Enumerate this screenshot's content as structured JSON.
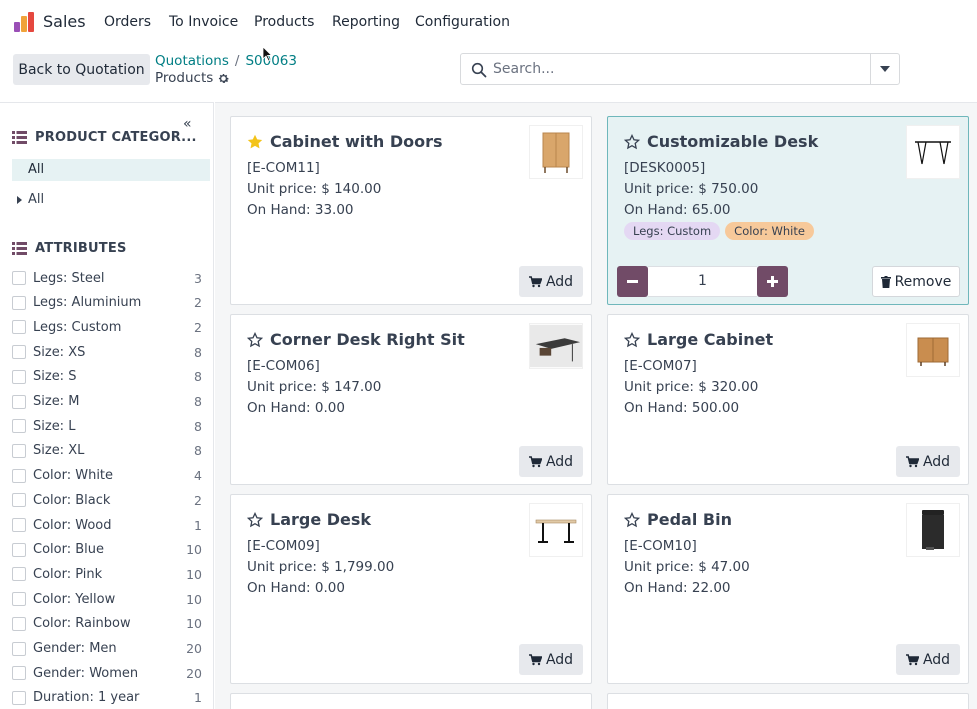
{
  "app": {
    "name": "Sales"
  },
  "menu": [
    "Orders",
    "To Invoice",
    "Products",
    "Reporting",
    "Configuration"
  ],
  "control": {
    "back_label": "Back to Quotation",
    "breadcrumb": [
      "Quotations",
      "S00063"
    ],
    "breadcrumb_sep": "/",
    "subtitle": "Products",
    "search_placeholder": "Search..."
  },
  "sidebar": {
    "collapse_glyph": "«",
    "categories_title": "PRODUCT CATEGOR...",
    "category_active": "All",
    "category_child": "All",
    "attributes_title": "ATTRIBUTES",
    "attributes": [
      {
        "label": "Legs: Steel",
        "count": "3"
      },
      {
        "label": "Legs: Aluminium",
        "count": "2"
      },
      {
        "label": "Legs: Custom",
        "count": "2"
      },
      {
        "label": "Size: XS",
        "count": "8"
      },
      {
        "label": "Size: S",
        "count": "8"
      },
      {
        "label": "Size: M",
        "count": "8"
      },
      {
        "label": "Size: L",
        "count": "8"
      },
      {
        "label": "Size: XL",
        "count": "8"
      },
      {
        "label": "Color: White",
        "count": "4"
      },
      {
        "label": "Color: Black",
        "count": "2"
      },
      {
        "label": "Color: Wood",
        "count": "1"
      },
      {
        "label": "Color: Blue",
        "count": "10"
      },
      {
        "label": "Color: Pink",
        "count": "10"
      },
      {
        "label": "Color: Yellow",
        "count": "10"
      },
      {
        "label": "Color: Rainbow",
        "count": "10"
      },
      {
        "label": "Gender: Men",
        "count": "20"
      },
      {
        "label": "Gender: Women",
        "count": "20"
      },
      {
        "label": "Duration: 1 year",
        "count": "1"
      }
    ]
  },
  "products": [
    {
      "name": "Cabinet with Doors",
      "ref": "[E-COM11]",
      "price": "Unit price: $ 140.00",
      "onhand": "On Hand: 33.00",
      "favorite": true,
      "selected": false,
      "add_label": "Add",
      "thumb": "cabinet"
    },
    {
      "name": "Customizable Desk",
      "ref": "[DESK0005]",
      "price": "Unit price: $ 750.00",
      "onhand": "On Hand: 65.00",
      "favorite": false,
      "selected": true,
      "tags": [
        "Legs: Custom",
        "Color: White"
      ],
      "qty": "1",
      "remove_label": "Remove",
      "thumb": "desk-frame"
    },
    {
      "name": "Corner Desk Right Sit",
      "ref": "[E-COM06]",
      "price": "Unit price: $ 147.00",
      "onhand": "On Hand: 0.00",
      "favorite": false,
      "selected": false,
      "add_label": "Add",
      "thumb": "corner-desk"
    },
    {
      "name": "Large Cabinet",
      "ref": "[E-COM07]",
      "price": "Unit price: $ 320.00",
      "onhand": "On Hand: 500.00",
      "favorite": false,
      "selected": false,
      "add_label": "Add",
      "thumb": "large-cabinet"
    },
    {
      "name": "Large Desk",
      "ref": "[E-COM09]",
      "price": "Unit price: $ 1,799.00",
      "onhand": "On Hand: 0.00",
      "favorite": false,
      "selected": false,
      "add_label": "Add",
      "thumb": "large-desk"
    },
    {
      "name": "Pedal Bin",
      "ref": "[E-COM10]",
      "price": "Unit price: $ 47.00",
      "onhand": "On Hand: 22.00",
      "favorite": false,
      "selected": false,
      "add_label": "Add",
      "thumb": "pedal-bin"
    }
  ],
  "colors": {
    "brand": "#714b67",
    "link": "#017e84",
    "selected_bg": "#e6f2f3",
    "star": "#f3c319",
    "tag_purple": "#e4d8f3",
    "tag_orange": "#f7c99a"
  }
}
